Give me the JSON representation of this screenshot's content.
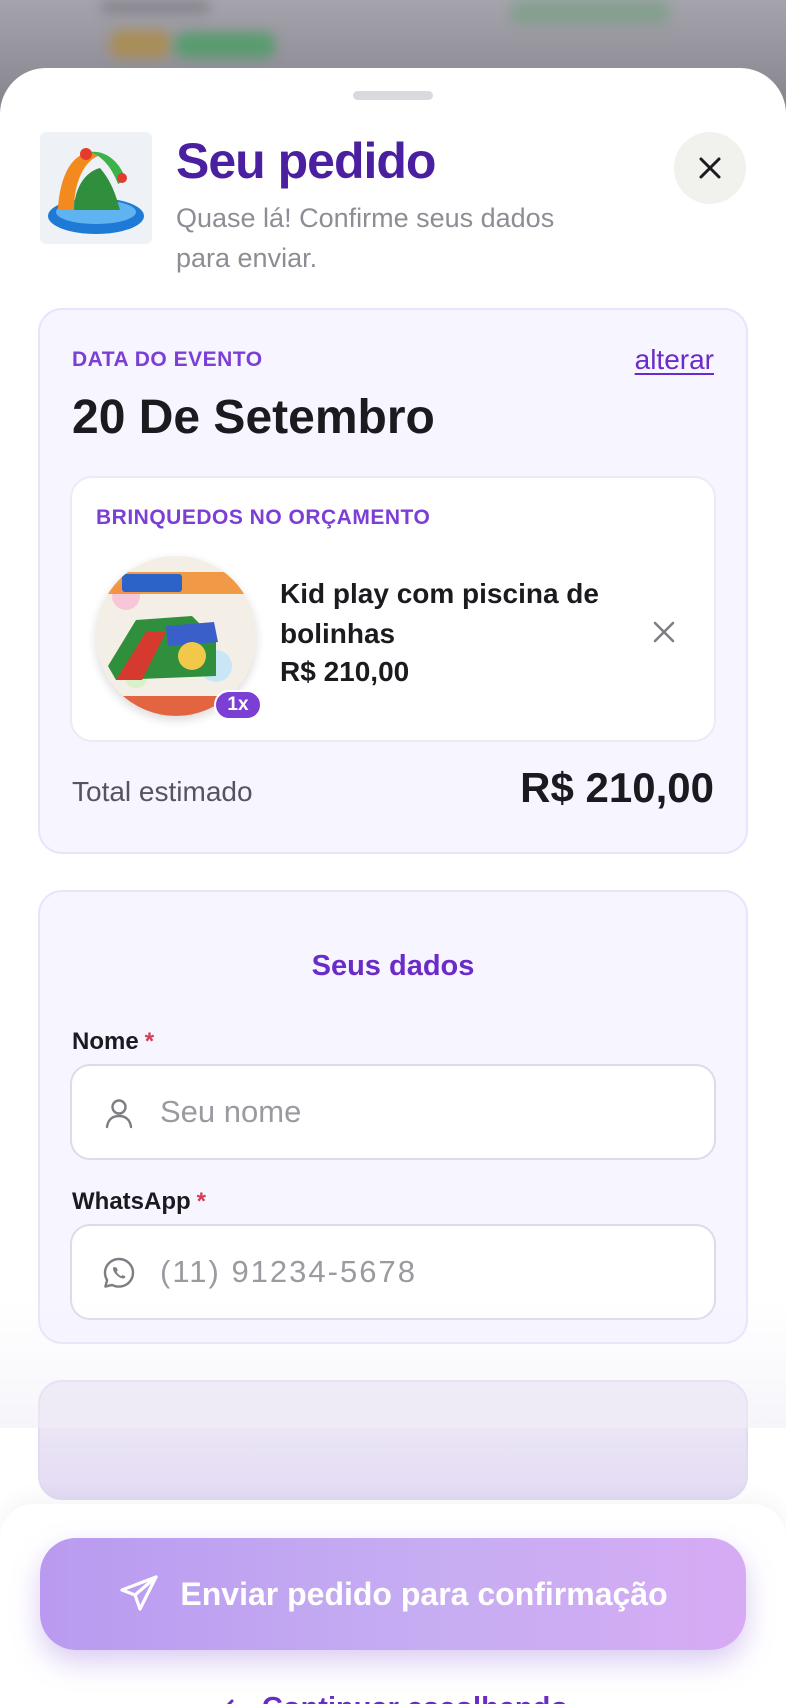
{
  "header": {
    "title": "Seu pedido",
    "subtitle": "Quase lá! Confirme seus dados para enviar."
  },
  "event": {
    "label": "DATA DO EVENTO",
    "change_label": "alterar",
    "date": "20 De Setembro"
  },
  "items_section": {
    "label": "BRINQUEDOS NO ORÇAMENTO",
    "items": [
      {
        "name": "Kid play com piscina de bolinhas",
        "price": "R$ 210,00",
        "qty": "1x"
      }
    ]
  },
  "total": {
    "label": "Total estimado",
    "value": "R$ 210,00"
  },
  "form": {
    "title": "Seus dados",
    "name_label": "Nome",
    "name_placeholder": "Seu nome",
    "whatsapp_label": "WhatsApp",
    "whatsapp_placeholder": "(11) 91234-5678",
    "required_mark": "*"
  },
  "footer": {
    "submit_label": "Enviar pedido para confirmação",
    "continue_label": "Continuar escolhendo"
  },
  "colors": {
    "brand_purple": "#4a1fa0",
    "accent_purple": "#7c3fd6",
    "required_red": "#d83a52"
  }
}
